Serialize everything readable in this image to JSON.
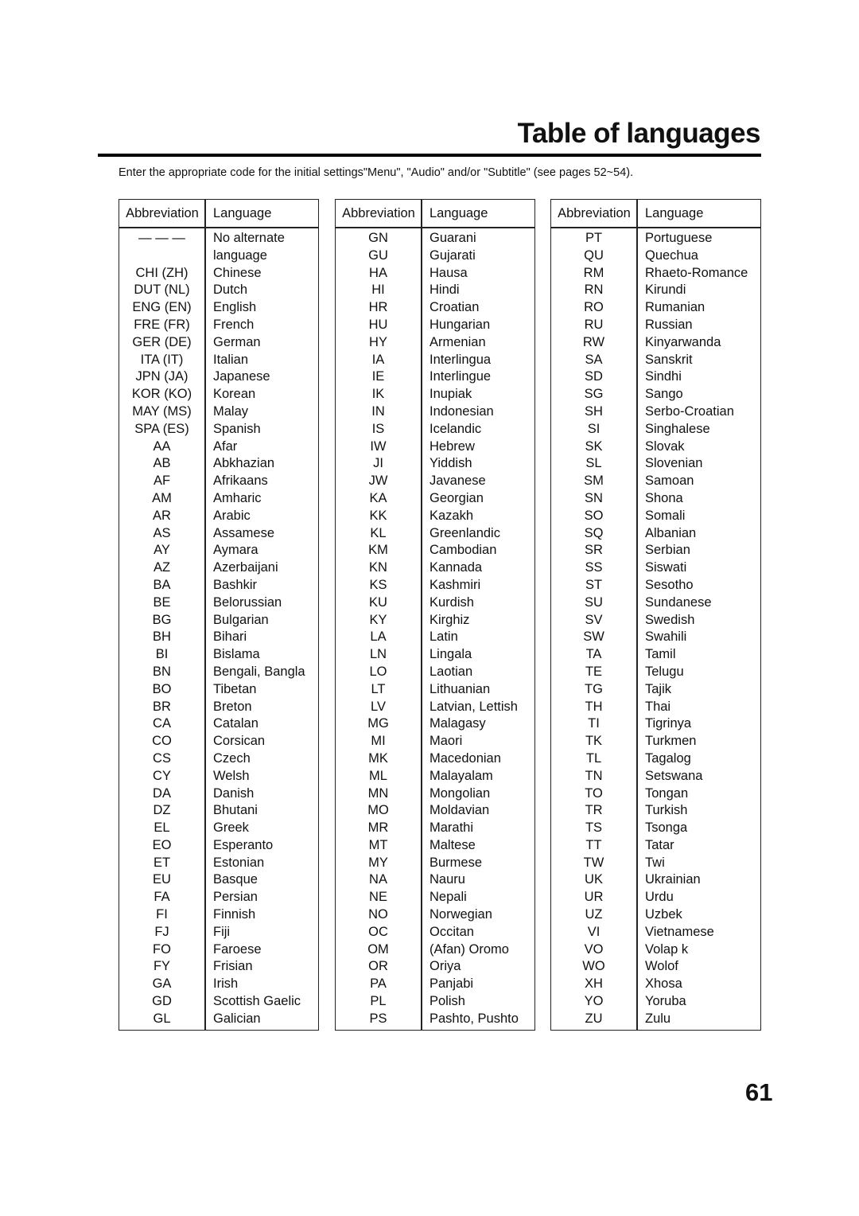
{
  "page": {
    "title": "Table of languages",
    "intro": "Enter the appropriate code for the initial settings\"Menu\", \"Audio\" and/or \"Subtitle\" (see pages 52~54).",
    "page_number": "61"
  },
  "tables": [
    {
      "header_abbr": "Abbreviation",
      "header_lang": "Language",
      "rows": [
        [
          "— — —",
          "No alternate"
        ],
        [
          "",
          "language"
        ],
        [
          "CHI (ZH)",
          "Chinese"
        ],
        [
          "DUT (NL)",
          "Dutch"
        ],
        [
          "ENG (EN)",
          "English"
        ],
        [
          "FRE (FR)",
          "French"
        ],
        [
          "GER (DE)",
          "German"
        ],
        [
          "ITA (IT)",
          "Italian"
        ],
        [
          "JPN (JA)",
          "Japanese"
        ],
        [
          "KOR (KO)",
          "Korean"
        ],
        [
          "MAY (MS)",
          "Malay"
        ],
        [
          "SPA (ES)",
          "Spanish"
        ],
        [
          "AA",
          "Afar"
        ],
        [
          "AB",
          "Abkhazian"
        ],
        [
          "AF",
          "Afrikaans"
        ],
        [
          "AM",
          "Amharic"
        ],
        [
          "AR",
          "Arabic"
        ],
        [
          "AS",
          "Assamese"
        ],
        [
          "AY",
          "Aymara"
        ],
        [
          "AZ",
          "Azerbaijani"
        ],
        [
          "BA",
          "Bashkir"
        ],
        [
          "BE",
          "Belorussian"
        ],
        [
          "BG",
          "Bulgarian"
        ],
        [
          "BH",
          "Bihari"
        ],
        [
          "BI",
          "Bislama"
        ],
        [
          "BN",
          "Bengali, Bangla"
        ],
        [
          "BO",
          "Tibetan"
        ],
        [
          "BR",
          "Breton"
        ],
        [
          "CA",
          "Catalan"
        ],
        [
          "CO",
          "Corsican"
        ],
        [
          "CS",
          "Czech"
        ],
        [
          "CY",
          "Welsh"
        ],
        [
          "DA",
          "Danish"
        ],
        [
          "DZ",
          "Bhutani"
        ],
        [
          "EL",
          "Greek"
        ],
        [
          "EO",
          "Esperanto"
        ],
        [
          "ET",
          "Estonian"
        ],
        [
          "EU",
          "Basque"
        ],
        [
          "FA",
          "Persian"
        ],
        [
          "FI",
          "Finnish"
        ],
        [
          "FJ",
          "Fiji"
        ],
        [
          "FO",
          "Faroese"
        ],
        [
          "FY",
          "Frisian"
        ],
        [
          "GA",
          "Irish"
        ],
        [
          "GD",
          "Scottish Gaelic"
        ],
        [
          "GL",
          "Galician"
        ]
      ]
    },
    {
      "header_abbr": "Abbreviation",
      "header_lang": "Language",
      "rows": [
        [
          "GN",
          "Guarani"
        ],
        [
          "GU",
          "Gujarati"
        ],
        [
          "HA",
          "Hausa"
        ],
        [
          "HI",
          "Hindi"
        ],
        [
          "HR",
          "Croatian"
        ],
        [
          "HU",
          "Hungarian"
        ],
        [
          "HY",
          "Armenian"
        ],
        [
          "IA",
          "Interlingua"
        ],
        [
          "IE",
          "Interlingue"
        ],
        [
          "IK",
          "Inupiak"
        ],
        [
          "IN",
          "Indonesian"
        ],
        [
          "IS",
          "Icelandic"
        ],
        [
          "IW",
          "Hebrew"
        ],
        [
          "JI",
          "Yiddish"
        ],
        [
          "JW",
          "Javanese"
        ],
        [
          "KA",
          "Georgian"
        ],
        [
          "KK",
          "Kazakh"
        ],
        [
          "KL",
          "Greenlandic"
        ],
        [
          "KM",
          "Cambodian"
        ],
        [
          "KN",
          "Kannada"
        ],
        [
          "KS",
          "Kashmiri"
        ],
        [
          "KU",
          "Kurdish"
        ],
        [
          "KY",
          "Kirghiz"
        ],
        [
          "LA",
          "Latin"
        ],
        [
          "LN",
          "Lingala"
        ],
        [
          "LO",
          "Laotian"
        ],
        [
          "LT",
          "Lithuanian"
        ],
        [
          "LV",
          "Latvian, Lettish"
        ],
        [
          "MG",
          "Malagasy"
        ],
        [
          "MI",
          "Maori"
        ],
        [
          "MK",
          "Macedonian"
        ],
        [
          "ML",
          "Malayalam"
        ],
        [
          "MN",
          "Mongolian"
        ],
        [
          "MO",
          "Moldavian"
        ],
        [
          "MR",
          "Marathi"
        ],
        [
          "MT",
          "Maltese"
        ],
        [
          "MY",
          "Burmese"
        ],
        [
          "NA",
          "Nauru"
        ],
        [
          "NE",
          "Nepali"
        ],
        [
          "NO",
          "Norwegian"
        ],
        [
          "OC",
          "Occitan"
        ],
        [
          "OM",
          "(Afan) Oromo"
        ],
        [
          "OR",
          "Oriya"
        ],
        [
          "PA",
          "Panjabi"
        ],
        [
          "PL",
          "Polish"
        ],
        [
          "PS",
          "Pashto, Pushto"
        ]
      ]
    },
    {
      "header_abbr": "Abbreviation",
      "header_lang": "Language",
      "rows": [
        [
          "PT",
          "Portuguese"
        ],
        [
          "QU",
          "Quechua"
        ],
        [
          "RM",
          "Rhaeto-Romance"
        ],
        [
          "RN",
          "Kirundi"
        ],
        [
          "RO",
          "Rumanian"
        ],
        [
          "RU",
          "Russian"
        ],
        [
          "RW",
          "Kinyarwanda"
        ],
        [
          "SA",
          "Sanskrit"
        ],
        [
          "SD",
          "Sindhi"
        ],
        [
          "SG",
          "Sango"
        ],
        [
          "SH",
          "Serbo-Croatian"
        ],
        [
          "SI",
          "Singhalese"
        ],
        [
          "SK",
          "Slovak"
        ],
        [
          "SL",
          "Slovenian"
        ],
        [
          "SM",
          "Samoan"
        ],
        [
          "SN",
          "Shona"
        ],
        [
          "SO",
          "Somali"
        ],
        [
          "SQ",
          "Albanian"
        ],
        [
          "SR",
          "Serbian"
        ],
        [
          "SS",
          "Siswati"
        ],
        [
          "ST",
          "Sesotho"
        ],
        [
          "SU",
          "Sundanese"
        ],
        [
          "SV",
          "Swedish"
        ],
        [
          "SW",
          "Swahili"
        ],
        [
          "TA",
          "Tamil"
        ],
        [
          "TE",
          "Telugu"
        ],
        [
          "TG",
          "Tajik"
        ],
        [
          "TH",
          "Thai"
        ],
        [
          "TI",
          "Tigrinya"
        ],
        [
          "TK",
          "Turkmen"
        ],
        [
          "TL",
          "Tagalog"
        ],
        [
          "TN",
          "Setswana"
        ],
        [
          "TO",
          "Tongan"
        ],
        [
          "TR",
          "Turkish"
        ],
        [
          "TS",
          "Tsonga"
        ],
        [
          "TT",
          "Tatar"
        ],
        [
          "TW",
          "Twi"
        ],
        [
          "UK",
          "Ukrainian"
        ],
        [
          "UR",
          "Urdu"
        ],
        [
          "UZ",
          "Uzbek"
        ],
        [
          "VI",
          "Vietnamese"
        ],
        [
          "VO",
          "Volap  k"
        ],
        [
          "WO",
          "Wolof"
        ],
        [
          "XH",
          "Xhosa"
        ],
        [
          "YO",
          "Yoruba"
        ],
        [
          "ZU",
          "Zulu"
        ]
      ]
    }
  ]
}
